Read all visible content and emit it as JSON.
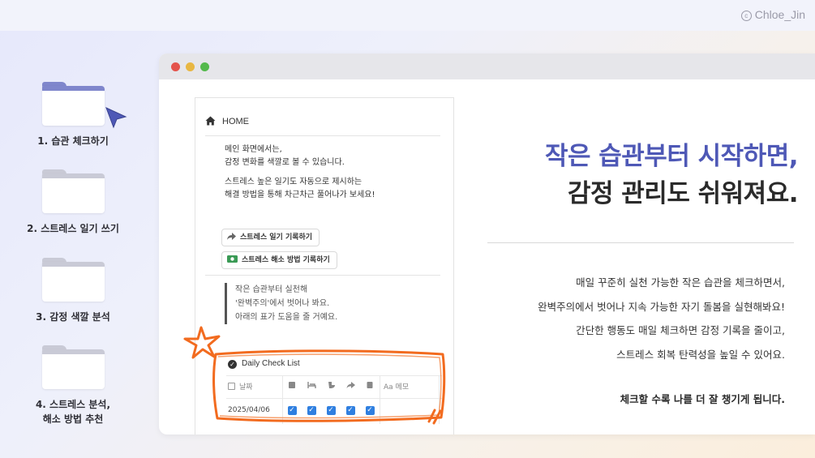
{
  "copyright": {
    "symbol": "c",
    "name": "Chloe_Jin"
  },
  "folders": [
    {
      "label": "1. 습관 체크하기",
      "active": true
    },
    {
      "label": "2. 스트레스 일기 쓰기",
      "active": false
    },
    {
      "label": "3. 감정 색깔 분석",
      "active": false
    },
    {
      "label_line1": "4. 스트레스 분석,",
      "label_line2": "해소 방법 추천",
      "active": false
    }
  ],
  "colors": {
    "accent": "#4e58b6",
    "folder_active_tab": "#7f86cc",
    "folder_tab": "#c9cad6",
    "highlight_orange": "#f26b1f",
    "checkbox_blue": "#2f7fe0"
  },
  "notion": {
    "home_label": "HOME",
    "intro_line1": "메인 화면에서는,",
    "intro_line2": "감정 변화를 색깔로 볼 수 있습니다.",
    "intro_line3": "스트레스 높은 일기도 자동으로 제시하는",
    "intro_line4": "해결 방법을 통해 차근차근 풀어나가 보세요!",
    "button1_label": "스트레스 일기 기록하기",
    "button2_label": "스트레스 해소 방법 기록하기",
    "quote_line1": "작은 습관부터 실천해",
    "quote_line2": "'완벽주의'에서 벗어나 봐요.",
    "quote_line3": "아래의 표가 도움을 줄 거예요.",
    "checklist_title": "Daily Check List",
    "table_headers": {
      "date": "날짜",
      "memo": "메모",
      "memo_prefix": "Aa"
    },
    "row": {
      "date": "2025/04/06",
      "checks": [
        true,
        true,
        true,
        true,
        true
      ]
    }
  },
  "headline": {
    "line1": "작은 습관부터 시작하면,",
    "line2": "감정 관리도 쉬워져요."
  },
  "body": {
    "line1": "매일 꾸준히 실천 가능한 작은 습관을 체크하면서,",
    "line2": "완벽주의에서 벗어나 지속 가능한 자기 돌봄을 실현해봐요!",
    "line3": "간단한 행동도 매일 체크하면 감정 기록을 줄이고,",
    "line4": "스트레스 회복 탄력성을 높일 수 있어요.",
    "closing": "체크할 수록 나를 더 잘 챙기게 됩니다."
  }
}
